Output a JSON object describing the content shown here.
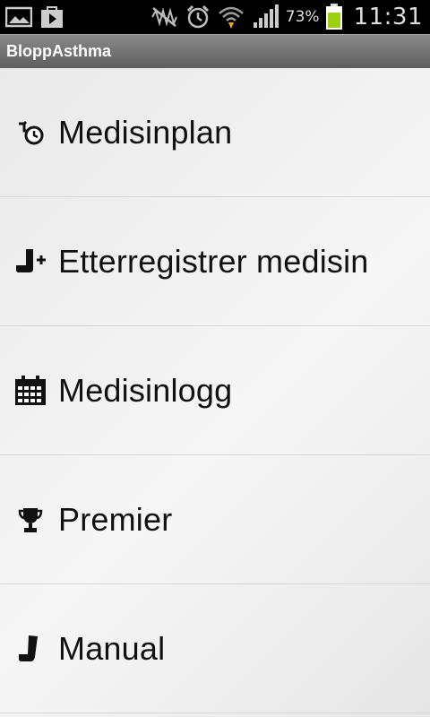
{
  "status_bar": {
    "battery_percent": "73%",
    "time": "11:31",
    "icons": [
      "gallery-icon",
      "play-store-icon",
      "mute-icon",
      "alarm-icon",
      "wifi-icon",
      "signal-icon",
      "battery-icon"
    ]
  },
  "app": {
    "title": "BloppAsthma"
  },
  "menu": {
    "items": [
      {
        "label": "Medisinplan",
        "icon": "inhaler-clock-icon"
      },
      {
        "label": "Etterregistrer medisin",
        "icon": "inhaler-plus-icon"
      },
      {
        "label": "Medisinlogg",
        "icon": "calendar-icon"
      },
      {
        "label": "Premier",
        "icon": "trophy-icon"
      },
      {
        "label": "Manual",
        "icon": "inhaler-icon"
      }
    ]
  },
  "colors": {
    "status_bar": "#000000",
    "title_bar": "#6f6f6f",
    "battery": "#9bd10f",
    "wifi_arrow": "#f5a623"
  }
}
